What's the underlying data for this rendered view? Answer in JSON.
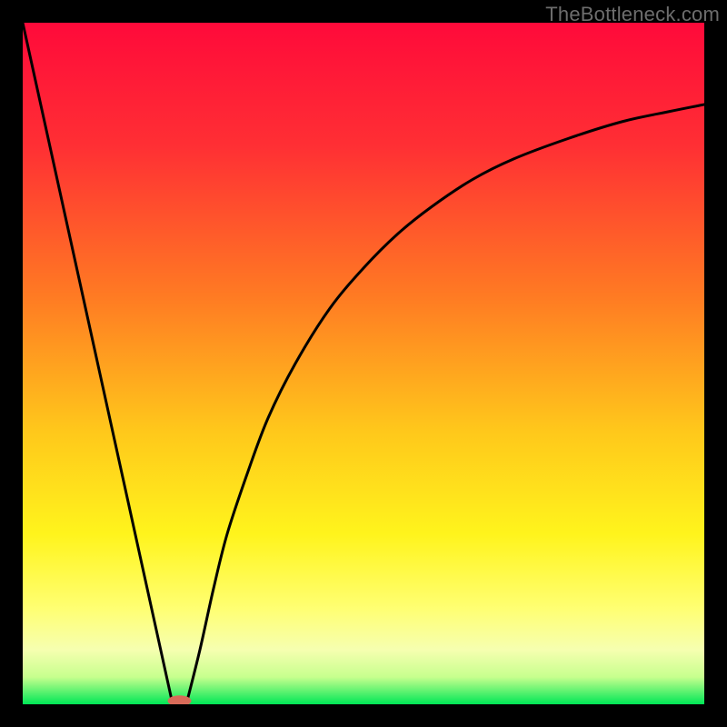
{
  "watermark": "TheBottleneck.com",
  "chart_data": {
    "type": "line",
    "title": "",
    "xlabel": "",
    "ylabel": "",
    "xlim": [
      0,
      100
    ],
    "ylim": [
      0,
      100
    ],
    "grid": false,
    "legend": false,
    "gradient_stops": [
      {
        "offset": 0,
        "color": "#ff0a3a"
      },
      {
        "offset": 18,
        "color": "#ff2f34"
      },
      {
        "offset": 40,
        "color": "#ff7a23"
      },
      {
        "offset": 60,
        "color": "#ffc81b"
      },
      {
        "offset": 75,
        "color": "#fff41c"
      },
      {
        "offset": 86,
        "color": "#ffff73"
      },
      {
        "offset": 92,
        "color": "#f6ffb0"
      },
      {
        "offset": 96,
        "color": "#c7ff8e"
      },
      {
        "offset": 100,
        "color": "#00e756"
      }
    ],
    "series": [
      {
        "name": "bottleneck-curve-left",
        "x": [
          0,
          22
        ],
        "y": [
          100,
          0
        ]
      },
      {
        "name": "bottleneck-curve-right",
        "x": [
          24,
          26,
          28,
          30,
          33,
          36,
          40,
          45,
          50,
          55,
          60,
          66,
          72,
          80,
          88,
          95,
          100
        ],
        "y": [
          0,
          8,
          17,
          25,
          34,
          42,
          50,
          58,
          64,
          69,
          73,
          77,
          80,
          83,
          85.5,
          87,
          88
        ]
      }
    ],
    "marker": {
      "x": 23,
      "y": 0.5,
      "color": "#d96b59",
      "label": ""
    }
  }
}
